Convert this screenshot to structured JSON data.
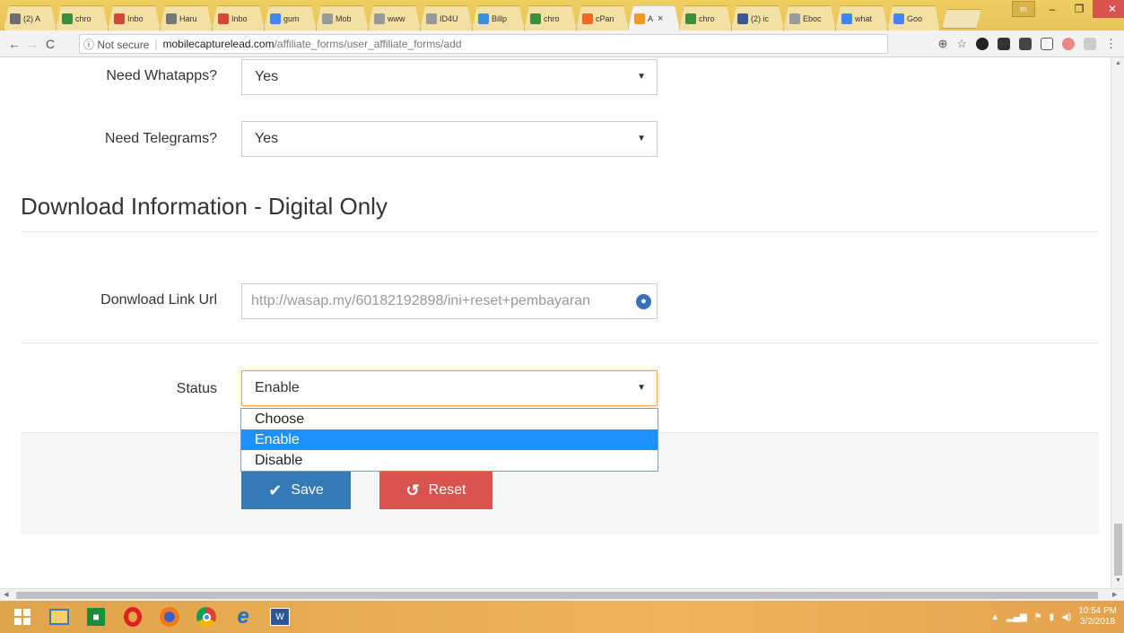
{
  "browser": {
    "tabs": [
      {
        "label": "(2) A",
        "fav": "#6d6d6d"
      },
      {
        "label": "chro",
        "fav": "#3c8d3c"
      },
      {
        "label": "Inbo",
        "fav": "#d44638"
      },
      {
        "label": "Haru",
        "fav": "#777"
      },
      {
        "label": "Inbo",
        "fav": "#d44638"
      },
      {
        "label": "gum",
        "fav": "#4285f4"
      },
      {
        "label": "Mob",
        "fav": "#999"
      },
      {
        "label": "www",
        "fav": "#999"
      },
      {
        "label": "ID4U",
        "fav": "#999"
      },
      {
        "label": "Billp",
        "fav": "#3b8fd9"
      },
      {
        "label": "chro",
        "fav": "#3c8d3c"
      },
      {
        "label": "cPan",
        "fav": "#f26a21"
      },
      {
        "label": "A",
        "fav": "#f29a1f",
        "active": true
      },
      {
        "label": "chro",
        "fav": "#3c8d3c"
      },
      {
        "label": "(2) ic",
        "fav": "#3b5998"
      },
      {
        "label": "Eboc",
        "fav": "#999"
      },
      {
        "label": "what",
        "fav": "#4285f4"
      },
      {
        "label": "Goo",
        "fav": "#4285f4"
      }
    ],
    "window_user": "m",
    "minimize": "–",
    "restore": "❐",
    "close": "✕",
    "url_info": "ⓘ Not secure",
    "url_host": "mobilecapturelead.com",
    "url_path": "/affiliate_forms/user_affiliate_forms/add"
  },
  "form": {
    "whatsapp": {
      "label": "Need Whatapps?",
      "value": "Yes"
    },
    "telegram": {
      "label": "Need Telegrams?",
      "value": "Yes"
    },
    "section_title": "Download Information - Digital Only",
    "download": {
      "label": "Donwload Link Url",
      "value": "http://wasap.my/60182192898/ini+reset+pembayaran"
    },
    "status": {
      "label": "Status",
      "value": "Enable",
      "options": [
        "Choose",
        "Enable",
        "Disable"
      ],
      "highlighted": "Enable"
    },
    "save_label": "Save",
    "reset_label": "Reset"
  },
  "taskbar": {
    "time": "10:54 PM",
    "date": "3/2/2018"
  },
  "colors": {
    "save": "#337ab7",
    "reset": "#d9534f",
    "highlight": "#1e90ff",
    "focus": "#f0a65a"
  }
}
